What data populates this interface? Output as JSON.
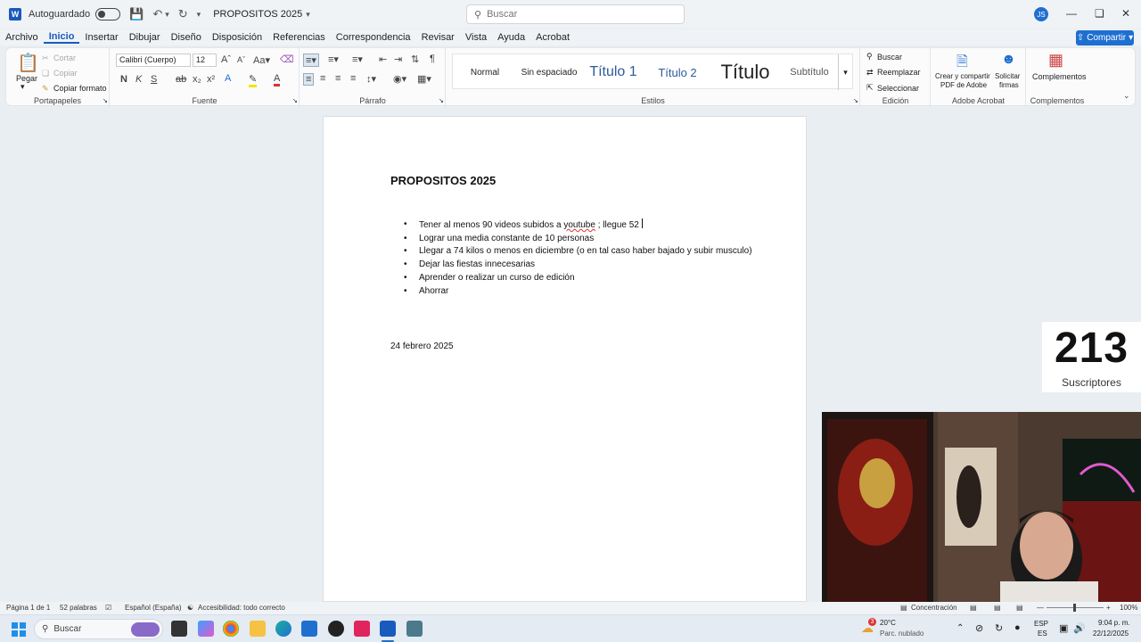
{
  "titlebar": {
    "app_icon": "W",
    "autosave_label": "Autoguardado",
    "doc_title": "PROPOSITOS 2025",
    "search_placeholder": "Buscar",
    "user_initials": "JS"
  },
  "menu": {
    "tabs": [
      "Archivo",
      "Inicio",
      "Insertar",
      "Dibujar",
      "Diseño",
      "Disposición",
      "Referencias",
      "Correspondencia",
      "Revisar",
      "Vista",
      "Ayuda",
      "Acrobat"
    ],
    "active_tab": "Inicio",
    "share_label": "Compartir"
  },
  "ribbon": {
    "clipboard": {
      "paste": "Pegar",
      "cut": "Cortar",
      "copy": "Copiar",
      "format_painter": "Copiar formato",
      "label": "Portapapeles"
    },
    "font": {
      "family": "Calibri (Cuerpo)",
      "size": "12",
      "bold": "N",
      "italic": "K",
      "underline": "S",
      "label": "Fuente"
    },
    "paragraph": {
      "label": "Párrafo"
    },
    "styles": {
      "items": [
        "Normal",
        "Sin espaciado",
        "Título 1",
        "Título 2",
        "Título",
        "Subtítulo"
      ],
      "label": "Estilos"
    },
    "editing": {
      "find": "Buscar",
      "replace": "Reemplazar",
      "select": "Seleccionar",
      "label": "Edición"
    },
    "acrobat": {
      "create_pdf_line1": "Crear y compartir",
      "create_pdf_line2": "PDF de Adobe",
      "request_sign_line1": "Solicitar",
      "request_sign_line2": "firmas",
      "label": "Adobe Acrobat"
    },
    "addins": {
      "button": "Complementos",
      "label": "Complementos"
    }
  },
  "document": {
    "heading": "PROPOSITOS 2025",
    "items": [
      {
        "before": "Tener al menos 90 videos subidos a ",
        "flagged": "youtube",
        "after": " ; llegue 52"
      },
      {
        "text": "Lograr una media constante de 10 personas"
      },
      {
        "text": "Llegar a 74 kilos o menos en diciembre (o en tal caso haber bajado y subir musculo)"
      },
      {
        "text": "Dejar las fiestas innecesarias"
      },
      {
        "text": "Aprender o realizar un curso de edición"
      },
      {
        "text": "Ahorrar"
      }
    ],
    "date": "24 febrero 2025"
  },
  "overlay": {
    "subscribers_count": "213",
    "subscribers_label": "Suscriptores"
  },
  "statusbar": {
    "page": "Página 1 de 1",
    "words": "52 palabras",
    "language": "Español (España)",
    "accessibility": "Accesibilidad: todo correcto",
    "focus": "Concentración",
    "zoom": "100%"
  },
  "taskbar": {
    "search_label": "Buscar",
    "weather_temp": "20°C",
    "weather_desc": "Parc. nublado",
    "weather_badge": "3",
    "lang_line1": "ESP",
    "lang_line2": "ES",
    "time": "9:04 p. m.",
    "date": "22/12/2025"
  },
  "colors": {
    "accent": "#185abd",
    "share": "#1f6fd1",
    "spell_error": "#d33"
  }
}
